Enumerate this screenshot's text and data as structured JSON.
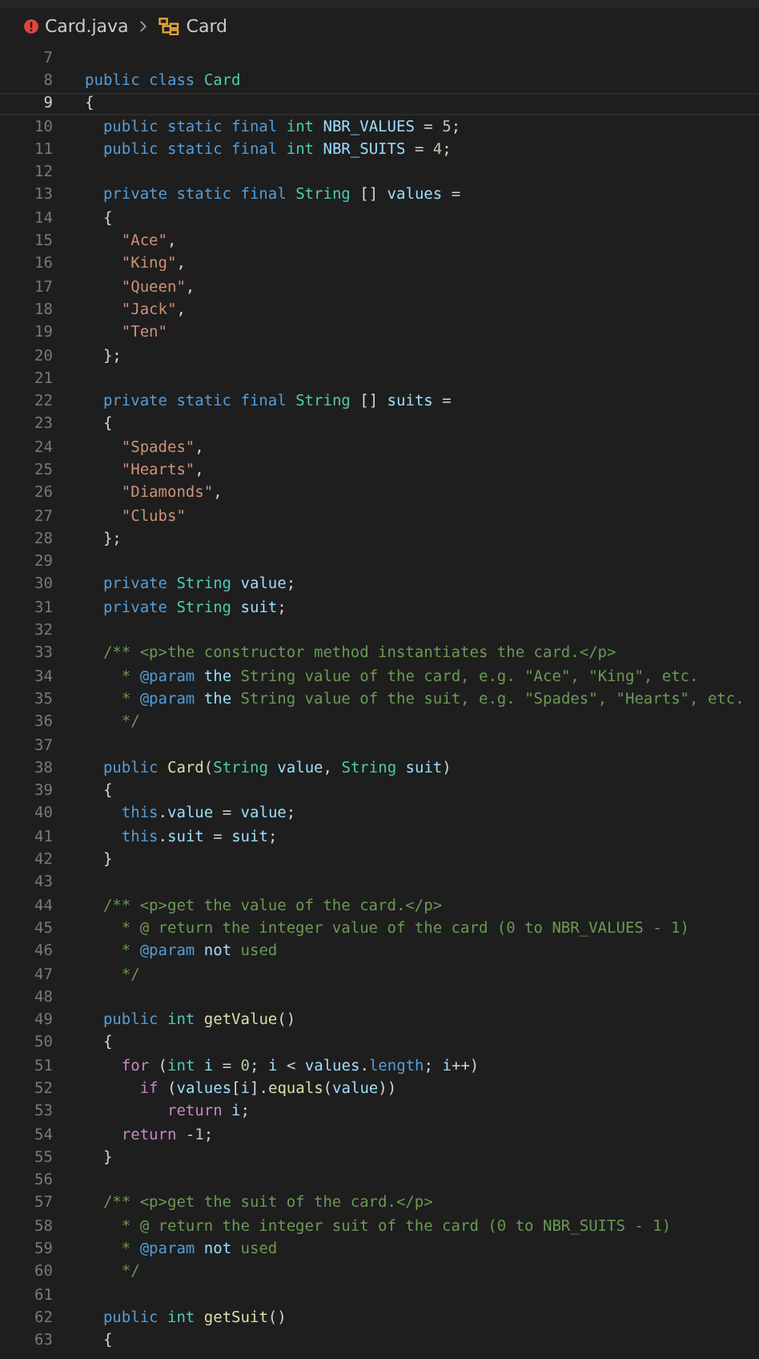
{
  "breadcrumb": {
    "file": "Card.java",
    "has_errors": true,
    "symbol": "Card"
  },
  "lines": [
    {
      "number": "7",
      "current": false
    },
    {
      "number": "8",
      "current": false,
      "tokens": [
        {
          "kind": "keyword",
          "text": "public class "
        },
        {
          "kind": "type",
          "text": "Card"
        }
      ]
    },
    {
      "number": "9",
      "current": true,
      "tokens": [
        {
          "kind": "plain",
          "text": "{"
        }
      ]
    },
    {
      "number": "10",
      "current": false,
      "tokens": [
        {
          "kind": "keyword",
          "text": "  public static final "
        },
        {
          "kind": "type",
          "text": "int"
        },
        {
          "kind": "variable",
          "text": " NBR_VALUES"
        },
        {
          "kind": "plain",
          "text": " = "
        },
        {
          "kind": "number",
          "text": "5"
        },
        {
          "kind": "plain",
          "text": ";"
        }
      ]
    },
    {
      "number": "11",
      "current": false,
      "tokens": [
        {
          "kind": "keyword",
          "text": "  public static final "
        },
        {
          "kind": "type",
          "text": "int"
        },
        {
          "kind": "variable",
          "text": " NBR_SUITS"
        },
        {
          "kind": "plain",
          "text": " = "
        },
        {
          "kind": "number",
          "text": "4"
        },
        {
          "kind": "plain",
          "text": ";"
        }
      ]
    },
    {
      "number": "12",
      "current": false
    },
    {
      "number": "13",
      "current": false,
      "tokens": [
        {
          "kind": "keyword",
          "text": "  private static final "
        },
        {
          "kind": "type",
          "text": "String"
        },
        {
          "kind": "plain",
          "text": " [] "
        },
        {
          "kind": "variable",
          "text": "values"
        },
        {
          "kind": "plain",
          "text": " ="
        }
      ]
    },
    {
      "number": "14",
      "current": false,
      "tokens": [
        {
          "kind": "plain",
          "text": "  {"
        }
      ]
    },
    {
      "number": "15",
      "current": false,
      "tokens": [
        {
          "kind": "string",
          "text": "    \"Ace\""
        },
        {
          "kind": "plain",
          "text": ","
        }
      ]
    },
    {
      "number": "16",
      "current": false,
      "tokens": [
        {
          "kind": "string",
          "text": "    \"King\""
        },
        {
          "kind": "plain",
          "text": ","
        }
      ]
    },
    {
      "number": "17",
      "current": false,
      "tokens": [
        {
          "kind": "string",
          "text": "    \"Queen\""
        },
        {
          "kind": "plain",
          "text": ","
        }
      ]
    },
    {
      "number": "18",
      "current": false,
      "tokens": [
        {
          "kind": "string",
          "text": "    \"Jack\""
        },
        {
          "kind": "plain",
          "text": ","
        }
      ]
    },
    {
      "number": "19",
      "current": false,
      "tokens": [
        {
          "kind": "string",
          "text": "    \"Ten\""
        }
      ]
    },
    {
      "number": "20",
      "current": false,
      "tokens": [
        {
          "kind": "plain",
          "text": "  };"
        }
      ]
    },
    {
      "number": "21",
      "current": false
    },
    {
      "number": "22",
      "current": false,
      "tokens": [
        {
          "kind": "keyword",
          "text": "  private static final "
        },
        {
          "kind": "type",
          "text": "String"
        },
        {
          "kind": "plain",
          "text": " [] "
        },
        {
          "kind": "variable",
          "text": "suits"
        },
        {
          "kind": "plain",
          "text": " ="
        }
      ]
    },
    {
      "number": "23",
      "current": false,
      "tokens": [
        {
          "kind": "plain",
          "text": "  {"
        }
      ]
    },
    {
      "number": "24",
      "current": false,
      "tokens": [
        {
          "kind": "string",
          "text": "    \"Spades\""
        },
        {
          "kind": "plain",
          "text": ","
        }
      ]
    },
    {
      "number": "25",
      "current": false,
      "tokens": [
        {
          "kind": "string",
          "text": "    \"Hearts\""
        },
        {
          "kind": "plain",
          "text": ","
        }
      ]
    },
    {
      "number": "26",
      "current": false,
      "tokens": [
        {
          "kind": "string",
          "text": "    \"Diamonds\""
        },
        {
          "kind": "plain",
          "text": ","
        }
      ]
    },
    {
      "number": "27",
      "current": false,
      "tokens": [
        {
          "kind": "string",
          "text": "    \"Clubs\""
        }
      ]
    },
    {
      "number": "28",
      "current": false,
      "tokens": [
        {
          "kind": "plain",
          "text": "  };"
        }
      ]
    },
    {
      "number": "29",
      "current": false
    },
    {
      "number": "30",
      "current": false,
      "tokens": [
        {
          "kind": "keyword",
          "text": "  private "
        },
        {
          "kind": "type",
          "text": "String"
        },
        {
          "kind": "variable",
          "text": " value"
        },
        {
          "kind": "plain",
          "text": ";"
        }
      ]
    },
    {
      "number": "31",
      "current": false,
      "tokens": [
        {
          "kind": "keyword",
          "text": "  private "
        },
        {
          "kind": "type",
          "text": "String"
        },
        {
          "kind": "variable",
          "text": " suit"
        },
        {
          "kind": "plain",
          "text": ";"
        }
      ]
    },
    {
      "number": "32",
      "current": false
    },
    {
      "number": "33",
      "current": false,
      "tokens": [
        {
          "kind": "comment",
          "text": "  /** <p>the constructor method instantiates the card.</p>"
        }
      ]
    },
    {
      "number": "34",
      "current": false,
      "tokens": [
        {
          "kind": "comment",
          "text": "    * "
        },
        {
          "kind": "tag",
          "text": "@param"
        },
        {
          "kind": "variable",
          "text": " the"
        },
        {
          "kind": "comment",
          "text": " String value of the card, e.g. \"Ace\", \"King\", etc."
        }
      ]
    },
    {
      "number": "35",
      "current": false,
      "tokens": [
        {
          "kind": "comment",
          "text": "    * "
        },
        {
          "kind": "tag",
          "text": "@param"
        },
        {
          "kind": "variable",
          "text": " the"
        },
        {
          "kind": "comment",
          "text": " String value of the suit, e.g. \"Spades\", \"Hearts\", etc."
        }
      ]
    },
    {
      "number": "36",
      "current": false,
      "tokens": [
        {
          "kind": "comment",
          "text": "    */"
        }
      ]
    },
    {
      "number": "37",
      "current": false
    },
    {
      "number": "38",
      "current": false,
      "tokens": [
        {
          "kind": "keyword",
          "text": "  public "
        },
        {
          "kind": "function",
          "text": "Card"
        },
        {
          "kind": "plain",
          "text": "("
        },
        {
          "kind": "type",
          "text": "String"
        },
        {
          "kind": "variable",
          "text": " value"
        },
        {
          "kind": "plain",
          "text": ", "
        },
        {
          "kind": "type",
          "text": "String"
        },
        {
          "kind": "variable",
          "text": " suit"
        },
        {
          "kind": "plain",
          "text": ")"
        }
      ]
    },
    {
      "number": "39",
      "current": false,
      "tokens": [
        {
          "kind": "plain",
          "text": "  {"
        }
      ]
    },
    {
      "number": "40",
      "current": false,
      "tokens": [
        {
          "kind": "keyword",
          "text": "    this"
        },
        {
          "kind": "plain",
          "text": "."
        },
        {
          "kind": "variable",
          "text": "value"
        },
        {
          "kind": "plain",
          "text": " = "
        },
        {
          "kind": "variable",
          "text": "value"
        },
        {
          "kind": "plain",
          "text": ";"
        }
      ]
    },
    {
      "number": "41",
      "current": false,
      "tokens": [
        {
          "kind": "keyword",
          "text": "    this"
        },
        {
          "kind": "plain",
          "text": "."
        },
        {
          "kind": "variable",
          "text": "suit"
        },
        {
          "kind": "plain",
          "text": " = "
        },
        {
          "kind": "variable",
          "text": "suit"
        },
        {
          "kind": "plain",
          "text": ";"
        }
      ]
    },
    {
      "number": "42",
      "current": false,
      "tokens": [
        {
          "kind": "plain",
          "text": "  }"
        }
      ]
    },
    {
      "number": "43",
      "current": false
    },
    {
      "number": "44",
      "current": false,
      "tokens": [
        {
          "kind": "comment",
          "text": "  /** <p>get the value of the card.</p>"
        }
      ]
    },
    {
      "number": "45",
      "current": false,
      "tokens": [
        {
          "kind": "comment",
          "text": "    * @ return the integer value of the card (0 to NBR_VALUES - 1)"
        }
      ]
    },
    {
      "number": "46",
      "current": false,
      "tokens": [
        {
          "kind": "comment",
          "text": "    * "
        },
        {
          "kind": "tag",
          "text": "@param"
        },
        {
          "kind": "variable",
          "text": " not"
        },
        {
          "kind": "comment",
          "text": " used"
        }
      ]
    },
    {
      "number": "47",
      "current": false,
      "tokens": [
        {
          "kind": "comment",
          "text": "    */"
        }
      ]
    },
    {
      "number": "48",
      "current": false
    },
    {
      "number": "49",
      "current": false,
      "tokens": [
        {
          "kind": "keyword",
          "text": "  public "
        },
        {
          "kind": "type",
          "text": "int"
        },
        {
          "kind": "function",
          "text": " getValue"
        },
        {
          "kind": "plain",
          "text": "()"
        }
      ]
    },
    {
      "number": "50",
      "current": false,
      "tokens": [
        {
          "kind": "plain",
          "text": "  {"
        }
      ]
    },
    {
      "number": "51",
      "current": false,
      "tokens": [
        {
          "kind": "control",
          "text": "    for"
        },
        {
          "kind": "plain",
          "text": " ("
        },
        {
          "kind": "type",
          "text": "int"
        },
        {
          "kind": "variable",
          "text": " i"
        },
        {
          "kind": "plain",
          "text": " = "
        },
        {
          "kind": "number",
          "text": "0"
        },
        {
          "kind": "plain",
          "text": "; "
        },
        {
          "kind": "variable",
          "text": "i"
        },
        {
          "kind": "plain",
          "text": " < "
        },
        {
          "kind": "variable",
          "text": "values"
        },
        {
          "kind": "plain",
          "text": "."
        },
        {
          "kind": "keyword",
          "text": "length"
        },
        {
          "kind": "plain",
          "text": "; "
        },
        {
          "kind": "variable",
          "text": "i"
        },
        {
          "kind": "plain",
          "text": "++)"
        }
      ]
    },
    {
      "number": "52",
      "current": false,
      "tokens": [
        {
          "kind": "control",
          "text": "      if"
        },
        {
          "kind": "plain",
          "text": " ("
        },
        {
          "kind": "variable",
          "text": "values"
        },
        {
          "kind": "plain",
          "text": "["
        },
        {
          "kind": "variable",
          "text": "i"
        },
        {
          "kind": "plain",
          "text": "]."
        },
        {
          "kind": "function",
          "text": "equals"
        },
        {
          "kind": "plain",
          "text": "("
        },
        {
          "kind": "variable",
          "text": "value"
        },
        {
          "kind": "plain",
          "text": "))"
        }
      ]
    },
    {
      "number": "53",
      "current": false,
      "tokens": [
        {
          "kind": "control",
          "text": "         return"
        },
        {
          "kind": "variable",
          "text": " i"
        },
        {
          "kind": "plain",
          "text": ";"
        }
      ]
    },
    {
      "number": "54",
      "current": false,
      "tokens": [
        {
          "kind": "control",
          "text": "    return"
        },
        {
          "kind": "plain",
          "text": " -"
        },
        {
          "kind": "number",
          "text": "1"
        },
        {
          "kind": "plain",
          "text": ";"
        }
      ]
    },
    {
      "number": "55",
      "current": false,
      "tokens": [
        {
          "kind": "plain",
          "text": "  }"
        }
      ]
    },
    {
      "number": "56",
      "current": false
    },
    {
      "number": "57",
      "current": false,
      "tokens": [
        {
          "kind": "comment",
          "text": "  /** <p>get the suit of the card.</p>"
        }
      ]
    },
    {
      "number": "58",
      "current": false,
      "tokens": [
        {
          "kind": "comment",
          "text": "    * @ return the integer suit of the card (0 to NBR_SUITS - 1)"
        }
      ]
    },
    {
      "number": "59",
      "current": false,
      "tokens": [
        {
          "kind": "comment",
          "text": "    * "
        },
        {
          "kind": "tag",
          "text": "@param"
        },
        {
          "kind": "variable",
          "text": " not"
        },
        {
          "kind": "comment",
          "text": " used"
        }
      ]
    },
    {
      "number": "60",
      "current": false,
      "tokens": [
        {
          "kind": "comment",
          "text": "    */"
        }
      ]
    },
    {
      "number": "61",
      "current": false
    },
    {
      "number": "62",
      "current": false,
      "tokens": [
        {
          "kind": "keyword",
          "text": "  public "
        },
        {
          "kind": "type",
          "text": "int"
        },
        {
          "kind": "function",
          "text": " getSuit"
        },
        {
          "kind": "plain",
          "text": "()"
        }
      ]
    },
    {
      "number": "63",
      "current": false,
      "tokens": [
        {
          "kind": "plain",
          "text": "  {"
        }
      ]
    }
  ]
}
